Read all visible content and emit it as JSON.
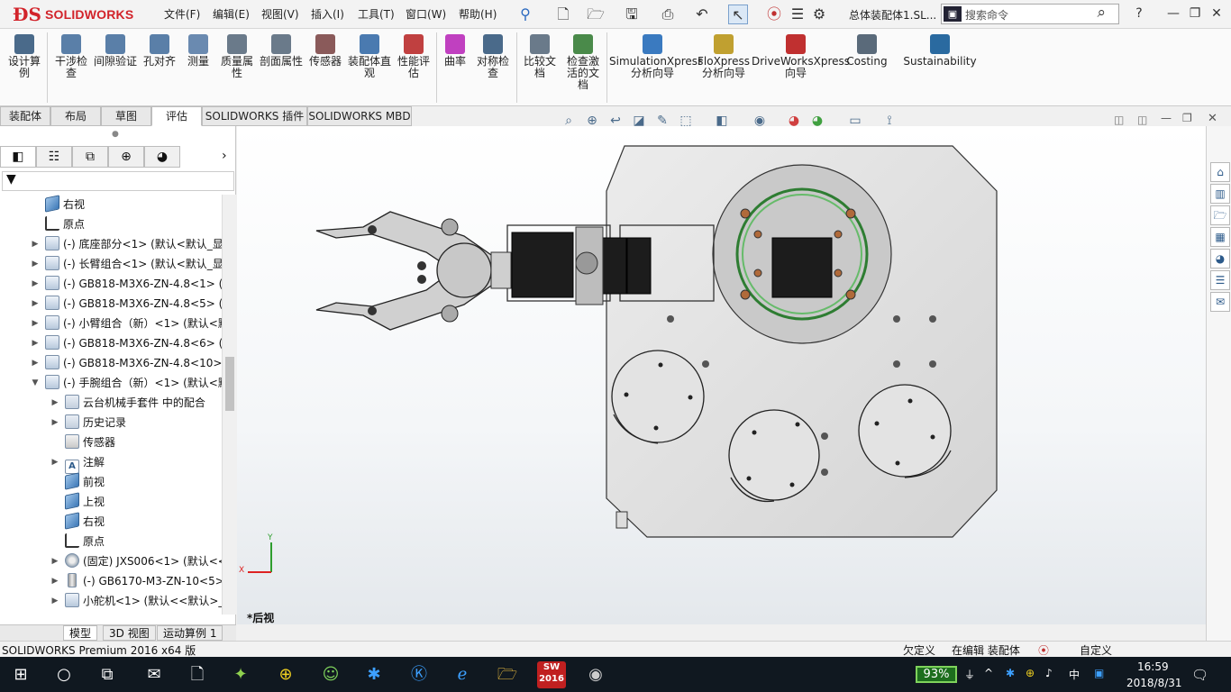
{
  "app": {
    "brand": "SOLIDWORKS",
    "document_title": "总体装配体1.SL...",
    "search_placeholder": "搜索命令",
    "help_glyph": "?"
  },
  "menu": [
    "文件(F)",
    "编辑(E)",
    "视图(V)",
    "插入(I)",
    "工具(T)",
    "窗口(W)",
    "帮助(H)"
  ],
  "ribbon": {
    "tools": [
      {
        "label": "设计算例",
        "color": "#4a6a8a"
      },
      {
        "label": "干涉检查",
        "color": "#5a7fa8"
      },
      {
        "label": "间隙验证",
        "color": "#5a7fa8"
      },
      {
        "label": "孔对齐",
        "color": "#5a7fa8"
      },
      {
        "label": "测量",
        "color": "#6a8ab0"
      },
      {
        "label": "质量属性",
        "color": "#6a7a8a"
      },
      {
        "label": "剖面属性",
        "color": "#6a7a8a"
      },
      {
        "label": "传感器",
        "color": "#8a5a5a"
      },
      {
        "label": "装配体直观",
        "color": "#4a7ab0"
      },
      {
        "label": "性能评估",
        "color": "#c04040"
      },
      {
        "label": "曲率",
        "color": "#c040c0"
      },
      {
        "label": "对称检查",
        "color": "#4a6a8a"
      },
      {
        "label": "比较文档",
        "color": "#6a7a8a"
      },
      {
        "label": "检查激活的文档",
        "color": "#4a8a4a"
      },
      {
        "label": "SimulationXpress 分析向导",
        "color": "#3a7ac0"
      },
      {
        "label": "FloXpress 分析向导",
        "color": "#c0a030"
      },
      {
        "label": "DriveWorksXpress 向导",
        "color": "#c03030"
      },
      {
        "label": "Costing",
        "color": "#5a6a7a"
      },
      {
        "label": "Sustainability",
        "color": "#2a6aa0"
      }
    ]
  },
  "command_tabs": [
    "装配体",
    "布局",
    "草图",
    "评估",
    "SOLIDWORKS 插件",
    "SOLIDWORKS MBD"
  ],
  "command_tabs_selected": "评估",
  "feature_tree": {
    "filter_glyph": "▼",
    "nodes": [
      {
        "label": "右视",
        "icon": "plane",
        "indent": 0,
        "expand": ""
      },
      {
        "label": "原点",
        "icon": "origin",
        "indent": 0,
        "expand": ""
      },
      {
        "label": "(-) 底座部分<1> (默认<默认_显示",
        "icon": "part",
        "indent": 0,
        "expand": "▶"
      },
      {
        "label": "(-) 长臂组合<1> (默认<默认_显示",
        "icon": "part",
        "indent": 0,
        "expand": "▶"
      },
      {
        "label": "(-) GB818-M3X6-ZN-4.8<1> (D",
        "icon": "part",
        "indent": 0,
        "expand": "▶"
      },
      {
        "label": "(-) GB818-M3X6-ZN-4.8<5> (D",
        "icon": "part",
        "indent": 0,
        "expand": "▶"
      },
      {
        "label": "(-) 小臂组合（新）<1> (默认<默",
        "icon": "part",
        "indent": 0,
        "expand": "▶"
      },
      {
        "label": "(-) GB818-M3X6-ZN-4.8<6> (D",
        "icon": "part",
        "indent": 0,
        "expand": "▶"
      },
      {
        "label": "(-) GB818-M3X6-ZN-4.8<10>",
        "icon": "part",
        "indent": 0,
        "expand": "▶"
      },
      {
        "label": "(-) 手腕组合（新）<1> (默认<默",
        "icon": "part",
        "indent": 0,
        "expand": "▼"
      },
      {
        "label": "云台机械手套件 中的配合",
        "icon": "folder",
        "indent": 1,
        "expand": "▶"
      },
      {
        "label": "历史记录",
        "icon": "folder",
        "indent": 1,
        "expand": "▶"
      },
      {
        "label": "传感器",
        "icon": "sensor",
        "indent": 1,
        "expand": ""
      },
      {
        "label": "注解",
        "icon": "note",
        "indent": 1,
        "expand": "▶"
      },
      {
        "label": "前视",
        "icon": "plane",
        "indent": 1,
        "expand": ""
      },
      {
        "label": "上视",
        "icon": "plane",
        "indent": 1,
        "expand": ""
      },
      {
        "label": "右视",
        "icon": "plane",
        "indent": 1,
        "expand": ""
      },
      {
        "label": "原点",
        "icon": "origin",
        "indent": 1,
        "expand": ""
      },
      {
        "label": "(固定) JXS006<1> (默认<<",
        "icon": "gear",
        "indent": 1,
        "expand": "▶"
      },
      {
        "label": "(-) GB6170-M3-ZN-10<5>",
        "icon": "screw",
        "indent": 1,
        "expand": "▶"
      },
      {
        "label": "小舵机<1> (默认<<默认>_显",
        "icon": "part",
        "indent": 1,
        "expand": "▶"
      }
    ]
  },
  "model_tabs": [
    "模型",
    "3D 视图",
    "运动算例 1"
  ],
  "model_tabs_selected": "模型",
  "status": {
    "product": "SOLIDWORKS Premium 2016 x64 版",
    "underdefined": "欠定义",
    "editing": "在编辑 装配体",
    "custom": "自定义"
  },
  "view": {
    "name": "*后视",
    "axis_x": "X",
    "axis_y": "Y"
  },
  "taskbar": {
    "battery": "93%",
    "ime": "中",
    "time": "16:59",
    "date": "2018/8/31",
    "sw_label": "SW 2016"
  }
}
